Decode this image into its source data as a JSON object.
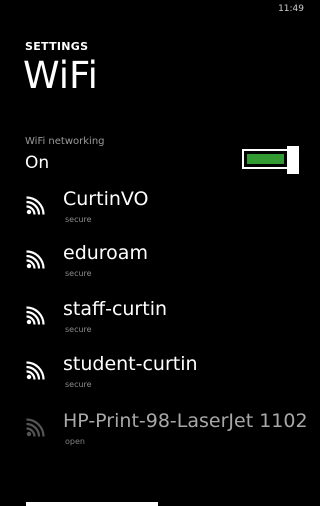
{
  "status_bar": {
    "time": "11:49"
  },
  "header": {
    "section": "SETTINGS",
    "title": "WiFi"
  },
  "wifi_toggle": {
    "caption": "WiFi networking",
    "value": "On",
    "enabled": true,
    "accent_color": "#339933"
  },
  "networks": [
    {
      "name": "CurtinVO",
      "status": "secure",
      "icon": "wifi-signal-icon",
      "signal": "strong"
    },
    {
      "name": "eduroam",
      "status": "secure",
      "icon": "wifi-signal-icon",
      "signal": "strong"
    },
    {
      "name": "staff-curtin",
      "status": "secure",
      "icon": "wifi-signal-icon",
      "signal": "strong"
    },
    {
      "name": "student-curtin",
      "status": "secure",
      "icon": "wifi-signal-icon",
      "signal": "strong"
    },
    {
      "name": "HP-Print-98-LaserJet 1102",
      "status": "open",
      "icon": "wifi-signal-icon",
      "signal": "weak"
    }
  ]
}
